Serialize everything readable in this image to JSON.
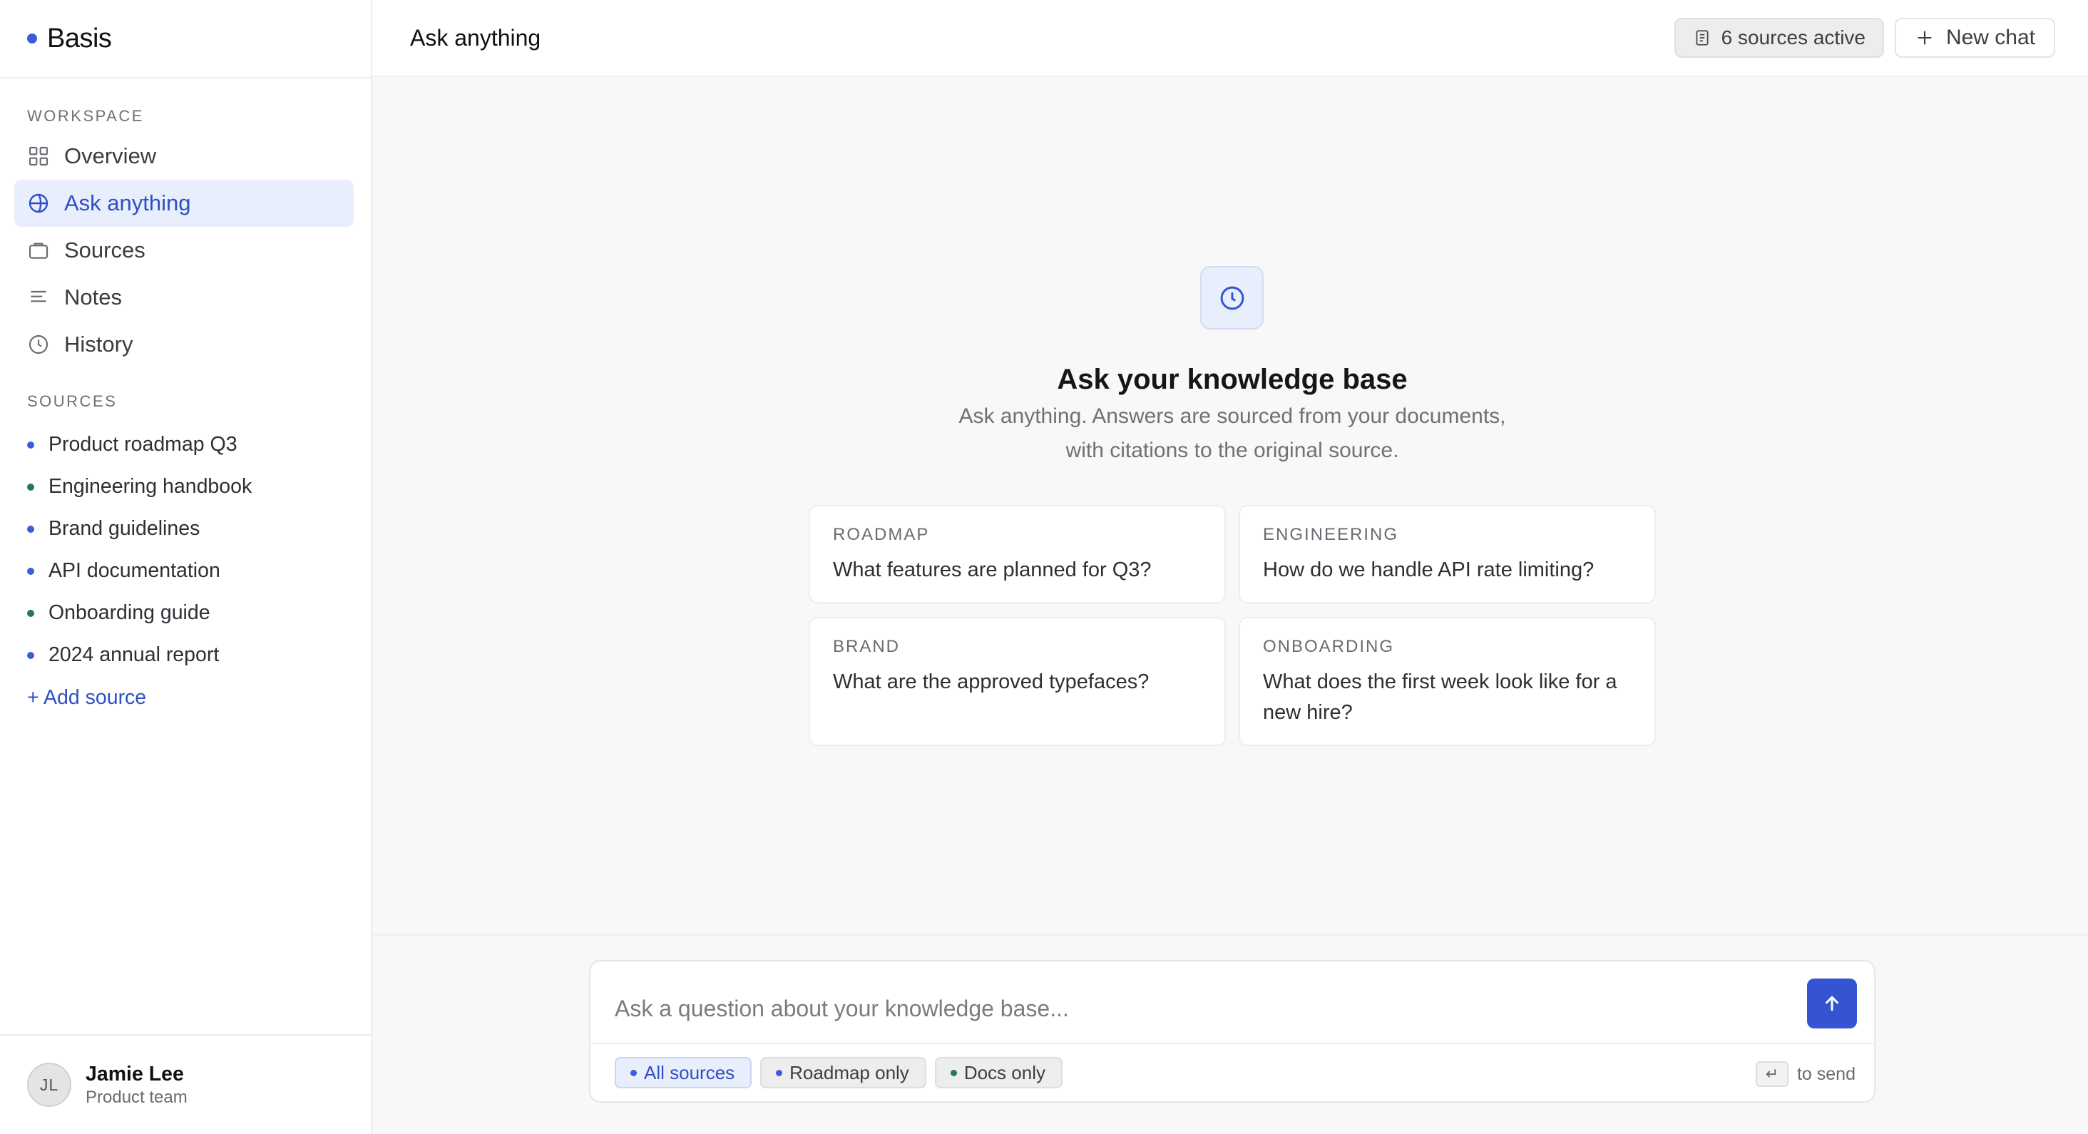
{
  "brand": {
    "name": "Basis"
  },
  "sidebar": {
    "workspace_label": "WORKSPACE",
    "nav": [
      {
        "label": "Overview",
        "icon": "grid-icon"
      },
      {
        "label": "Ask anything",
        "icon": "globe-icon",
        "active": true
      },
      {
        "label": "Sources",
        "icon": "folder-icon"
      },
      {
        "label": "Notes",
        "icon": "lines-icon"
      },
      {
        "label": "History",
        "icon": "clock-icon"
      }
    ],
    "sources_label": "SOURCES",
    "sources": [
      {
        "label": "Product roadmap Q3",
        "color": "#3b5bdb"
      },
      {
        "label": "Engineering handbook",
        "color": "#1f7a5a"
      },
      {
        "label": "Brand guidelines",
        "color": "#3b5bdb"
      },
      {
        "label": "API documentation",
        "color": "#3b5bdb"
      },
      {
        "label": "Onboarding guide",
        "color": "#1f7a5a"
      },
      {
        "label": "2024 annual report",
        "color": "#3b5bdb"
      }
    ],
    "add_source": "+ Add source",
    "user": {
      "initials": "JL",
      "name": "Jamie Lee",
      "team": "Product team"
    }
  },
  "header": {
    "title": "Ask anything",
    "sources_active": "6 sources active",
    "new_chat": "New chat"
  },
  "hero": {
    "icon": "clock-icon",
    "title": "Ask your knowledge base",
    "subtitle_line1": "Ask anything. Answers are sourced from your documents,",
    "subtitle_line2": "with citations to the original source."
  },
  "suggestions": [
    {
      "tag": "ROADMAP",
      "question": "What features are planned for Q3?"
    },
    {
      "tag": "ENGINEERING",
      "question": "How do we handle API rate limiting?"
    },
    {
      "tag": "BRAND",
      "question": "What are the approved typefaces?"
    },
    {
      "tag": "ONBOARDING",
      "question": "What does the first week look like for a new hire?"
    }
  ],
  "composer": {
    "placeholder": "Ask a question about your knowledge base...",
    "value": "",
    "filters": [
      {
        "label": "All sources",
        "color": "#3b5bdb",
        "active": true
      },
      {
        "label": "Roadmap only",
        "color": "#3b5bdb"
      },
      {
        "label": "Docs only",
        "color": "#1f7a5a"
      }
    ],
    "send_key": "↵",
    "send_hint": "to send"
  },
  "colors": {
    "accent": "#3554d1",
    "accent_soft": "#e8eefc",
    "green": "#1f7a5a"
  }
}
